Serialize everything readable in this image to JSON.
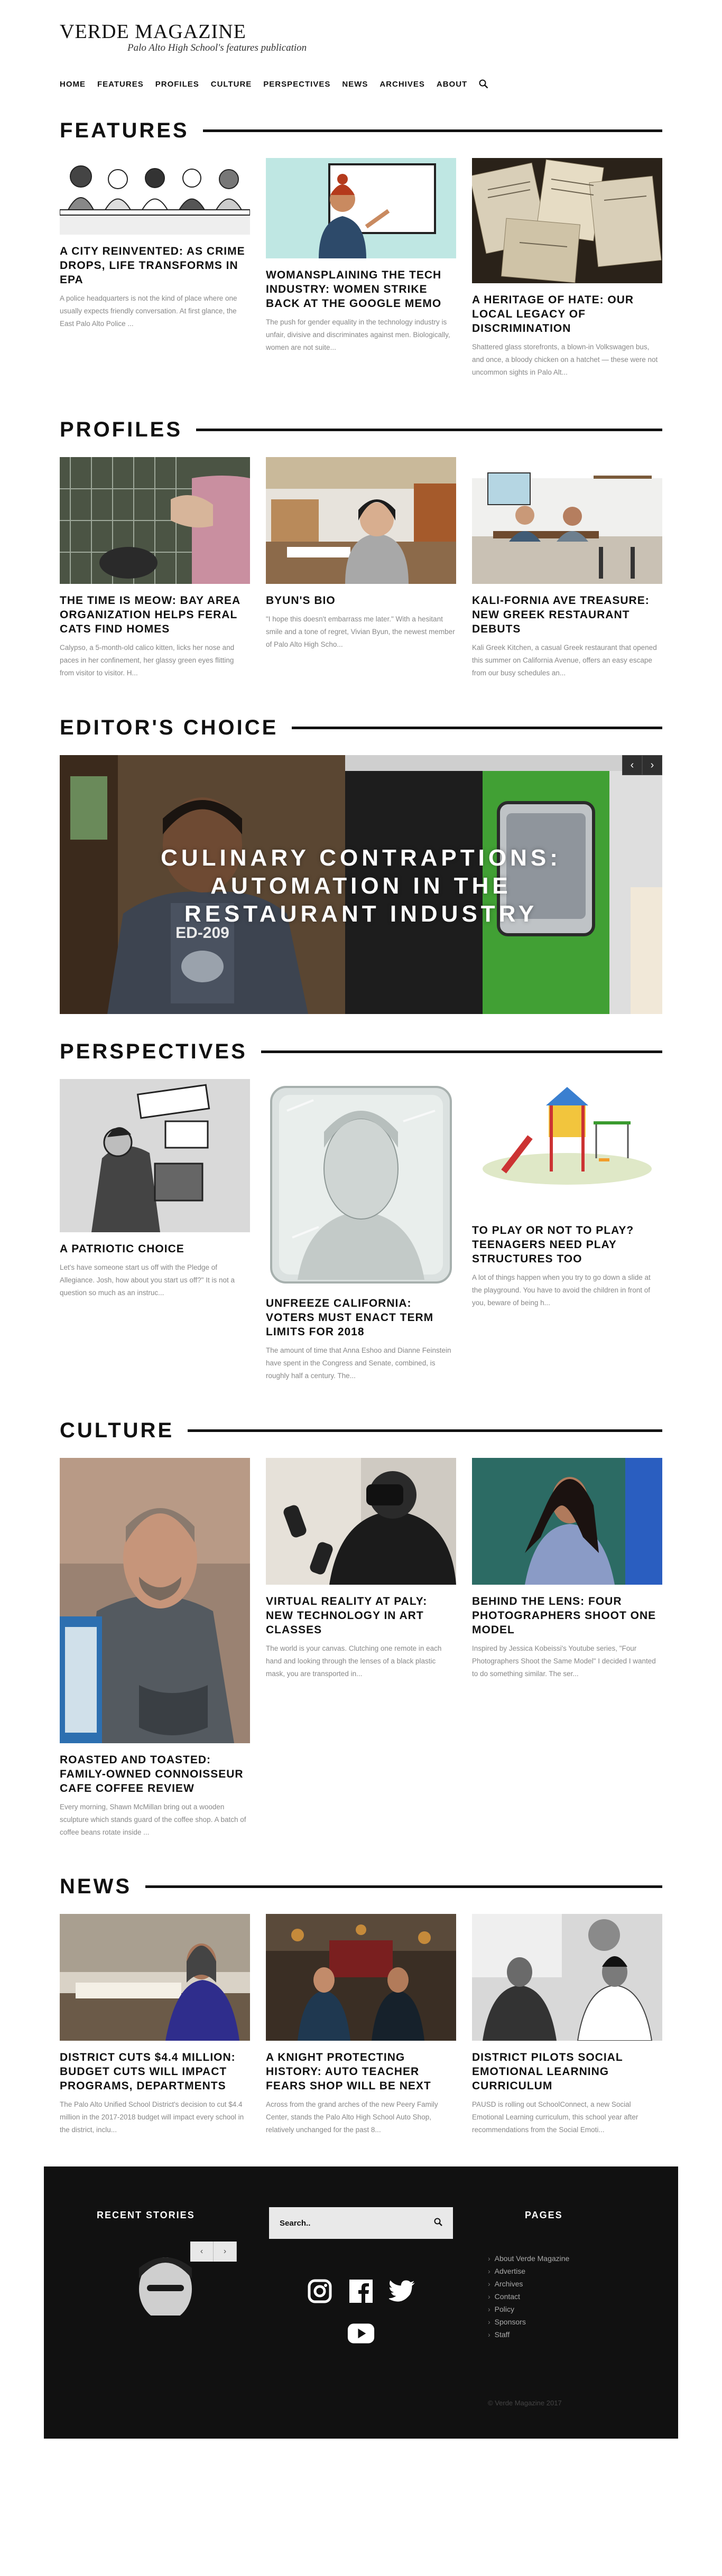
{
  "site": {
    "title": "Verde Magazine",
    "tagline": "Palo Alto High School's features publication"
  },
  "nav": [
    "HOME",
    "FEATURES",
    "PROFILES",
    "CULTURE",
    "PERSPECTIVES",
    "NEWS",
    "ARCHIVES",
    "ABOUT"
  ],
  "features": {
    "title": "FEATURES",
    "cards": [
      {
        "title": "A CITY REINVENTED: AS CRIME DROPS, LIFE TRANSFORMS IN EPA",
        "excerpt": "A police headquarters is not the kind of place where one usually expects friendly conversation. At first glance, the East Palo Alto Police ..."
      },
      {
        "title": "WOMANSPLAINING THE TECH INDUSTRY: WOMEN STRIKE BACK AT THE GOOGLE MEMO",
        "excerpt": "The push for gender equality in the technology industry is unfair, divisive and discriminates against men. Biologically, women are not suite..."
      },
      {
        "title": "A HERITAGE OF HATE: OUR LOCAL LEGACY OF DISCRIMINATION",
        "excerpt": "Shattered glass storefronts, a blown-in Volkswagen bus, and once, a bloody chicken on a hatchet — these were not uncommon sights in Palo Alt..."
      }
    ]
  },
  "profiles": {
    "title": "PROFILES",
    "cards": [
      {
        "title": "THE TIME IS MEOW: BAY AREA ORGANIZATION HELPS FERAL CATS FIND HOMES",
        "excerpt": "Calypso, a 5-month-old calico kitten, licks her nose and paces in her confinement, her glassy green eyes flitting from visitor to visitor. H..."
      },
      {
        "title": "BYUN'S BIO",
        "excerpt": "\"I hope this doesn't embarrass me later.\" With a hesitant smile and a tone of regret, Vivian Byun, the newest member of Palo Alto High Scho..."
      },
      {
        "title": "KALI-FORNIA AVE TREASURE: NEW GREEK RESTAURANT DEBUTS",
        "excerpt": "Kali Greek Kitchen, a casual Greek restaurant that opened this summer on California Avenue, offers an easy escape from our busy schedules an..."
      }
    ]
  },
  "editors_choice": {
    "title": "EDITOR'S CHOICE",
    "slide_title": "CULINARY CONTRAPTIONS: AUTOMATION IN THE RESTAURANT INDUSTRY",
    "shirt_text": "ED-209"
  },
  "perspectives": {
    "title": "PERSPECTIVES",
    "cards": [
      {
        "title": "A PATRIOTIC CHOICE",
        "excerpt": "Let's have someone start us off with the Pledge of Allegiance. Josh, how about you start us off?\" It is not a question so much as an instruc..."
      },
      {
        "title": "UNFREEZE CALIFORNIA: VOTERS MUST ENACT TERM LIMITS FOR 2018",
        "excerpt": "The amount of time that Anna Eshoo and Dianne Feinstein have spent in the Congress and Senate, combined, is roughly half a century. The..."
      },
      {
        "title": "TO PLAY OR NOT TO PLAY? TEENAGERS NEED PLAY STRUCTURES TOO",
        "excerpt": "A lot of things happen when you try to go down a slide at the playground. You have to avoid the children in front of you, beware of being h..."
      }
    ]
  },
  "culture": {
    "title": "CULTURE",
    "cards": [
      {
        "title": "ROASTED AND TOASTED: FAMILY-OWNED CONNOISSEUR CAFE COFFEE REVIEW",
        "excerpt": "Every morning, Shawn McMillan bring out a wooden sculpture which stands guard of the coffee shop. A batch of coffee beans rotate inside ..."
      },
      {
        "title": "VIRTUAL REALITY AT PALY: NEW TECHNOLOGY IN ART CLASSES",
        "excerpt": "The world is your canvas. Clutching one remote in each hand and looking through the lenses of a black plastic mask, you are transported in..."
      },
      {
        "title": "BEHIND THE LENS: FOUR PHOTOGRAPHERS SHOOT ONE MODEL",
        "excerpt": "Inspired by Jessica Kobeissi's Youtube series, \"Four Photographers Shoot the Same Model\" I decided I wanted to do something similar. The ser..."
      }
    ]
  },
  "news": {
    "title": "NEWS",
    "cards": [
      {
        "title": "DISTRICT CUTS $4.4 MILLION: BUDGET CUTS WILL IMPACT PROGRAMS, DEPARTMENTS",
        "excerpt": "The Palo Alto Unified School District's decision to cut $4.4 million in the 2017-2018 budget will impact every school in the district, inclu..."
      },
      {
        "title": "A KNIGHT PROTECTING HISTORY: AUTO TEACHER FEARS SHOP WILL BE NEXT",
        "excerpt": "Across from the grand arches of the new Peery Family Center, stands the Palo Alto High School Auto Shop, relatively unchanged for the past 8..."
      },
      {
        "title": "DISTRICT PILOTS SOCIAL EMOTIONAL LEARNING CURRICULUM",
        "excerpt": "PAUSD is rolling out SchoolConnect, a new Social Emotional Learning curriculum, this school year after recommendations from the Social Emoti..."
      }
    ]
  },
  "footer": {
    "recent_title": "RECENT STORIES",
    "search_placeholder": "Search..",
    "pages_title": "PAGES",
    "pages": [
      "About Verde Magazine",
      "Advertise",
      "Archives",
      "Contact",
      "Policy",
      "Sponsors",
      "Staff"
    ],
    "copyright": "© Verde Magazine 2017"
  },
  "colors": {
    "accent_green": "#3a9b2f",
    "footer_bg": "#111111"
  }
}
